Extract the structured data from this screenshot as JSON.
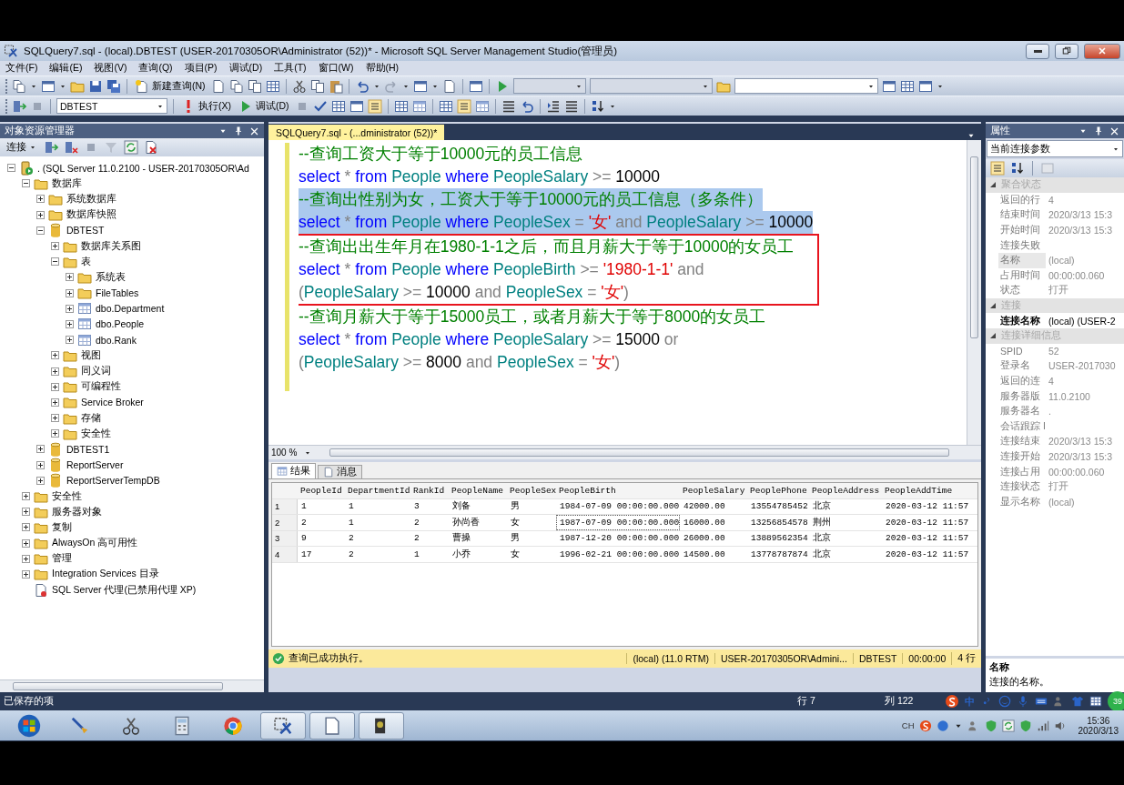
{
  "window": {
    "title": "SQLQuery7.sql - (local).DBTEST (USER-20170305OR\\Administrator (52))* - Microsoft SQL Server Management Studio(管理员)"
  },
  "menu": [
    "文件(F)",
    "编辑(E)",
    "视图(V)",
    "查询(Q)",
    "项目(P)",
    "调试(D)",
    "工具(T)",
    "窗口(W)",
    "帮助(H)"
  ],
  "toolbar": {
    "new_query": "新建查询(N)",
    "database": "DBTEST",
    "execute": "执行(X)",
    "debug": "调试(D)"
  },
  "object_explorer": {
    "title": "对象资源管理器",
    "connect": "连接",
    "tree": [
      {
        "label": ". (SQL Server 11.0.2100 - USER-20170305OR\\Ad",
        "kind": "server",
        "expanded": true,
        "children": [
          {
            "label": "数据库",
            "kind": "folder",
            "expanded": true,
            "children": [
              {
                "label": "系统数据库",
                "kind": "folder",
                "expanded": false
              },
              {
                "label": "数据库快照",
                "kind": "folder",
                "expanded": false
              },
              {
                "label": "DBTEST",
                "kind": "database",
                "expanded": true,
                "children": [
                  {
                    "label": "数据库关系图",
                    "kind": "folder",
                    "expanded": false
                  },
                  {
                    "label": "表",
                    "kind": "folder",
                    "expanded": true,
                    "children": [
                      {
                        "label": "系统表",
                        "kind": "folder",
                        "expanded": false
                      },
                      {
                        "label": "FileTables",
                        "kind": "folder",
                        "expanded": false
                      },
                      {
                        "label": "dbo.Department",
                        "kind": "table",
                        "expanded": false
                      },
                      {
                        "label": "dbo.People",
                        "kind": "table",
                        "expanded": false
                      },
                      {
                        "label": "dbo.Rank",
                        "kind": "table",
                        "expanded": false
                      }
                    ]
                  },
                  {
                    "label": "视图",
                    "kind": "folder",
                    "expanded": false
                  },
                  {
                    "label": "同义词",
                    "kind": "folder",
                    "expanded": false
                  },
                  {
                    "label": "可编程性",
                    "kind": "folder",
                    "expanded": false
                  },
                  {
                    "label": "Service Broker",
                    "kind": "folder",
                    "expanded": false
                  },
                  {
                    "label": "存储",
                    "kind": "folder",
                    "expanded": false
                  },
                  {
                    "label": "安全性",
                    "kind": "folder",
                    "expanded": false
                  }
                ]
              },
              {
                "label": "DBTEST1",
                "kind": "database",
                "expanded": false
              },
              {
                "label": "ReportServer",
                "kind": "database",
                "expanded": false
              },
              {
                "label": "ReportServerTempDB",
                "kind": "database",
                "expanded": false
              }
            ]
          },
          {
            "label": "安全性",
            "kind": "folder",
            "expanded": false
          },
          {
            "label": "服务器对象",
            "kind": "folder",
            "expanded": false
          },
          {
            "label": "复制",
            "kind": "folder",
            "expanded": false
          },
          {
            "label": "AlwaysOn 高可用性",
            "kind": "folder",
            "expanded": false
          },
          {
            "label": "管理",
            "kind": "folder",
            "expanded": false
          },
          {
            "label": "Integration Services 目录",
            "kind": "folder",
            "expanded": false
          },
          {
            "label": "SQL Server 代理(已禁用代理 XP)",
            "kind": "agent"
          }
        ]
      }
    ]
  },
  "editor": {
    "tab": "SQLQuery7.sql - (...dministrator (52))*",
    "zoom": "100 %",
    "lines": [
      {
        "selected": false,
        "boxed": false,
        "tokens": [
          {
            "kind": "comment",
            "text": "--查询工资大于等于10000元的员工信息"
          }
        ]
      },
      {
        "selected": false,
        "boxed": false,
        "tokens": [
          {
            "kind": "keyword",
            "text": "select"
          },
          {
            "kind": "operator",
            "text": " * "
          },
          {
            "kind": "keyword",
            "text": "from "
          },
          {
            "kind": "identifier",
            "text": "People "
          },
          {
            "kind": "keyword",
            "text": "where "
          },
          {
            "kind": "identifier",
            "text": "PeopleSalary"
          },
          {
            "kind": "operator",
            "text": " >= "
          },
          {
            "kind": "number",
            "text": "10000"
          }
        ]
      },
      {
        "selected": true,
        "boxed": false,
        "tokens": [
          {
            "kind": "comment",
            "text": "--查询出性别为女，工资大于等于10000元的员工信息（多条件）"
          }
        ]
      },
      {
        "selected": true,
        "boxed": false,
        "tokens": [
          {
            "kind": "keyword",
            "text": "select"
          },
          {
            "kind": "operator",
            "text": " * "
          },
          {
            "kind": "keyword",
            "text": "from "
          },
          {
            "kind": "identifier",
            "text": "People "
          },
          {
            "kind": "keyword",
            "text": "where "
          },
          {
            "kind": "identifier",
            "text": "PeopleSex"
          },
          {
            "kind": "operator",
            "text": " = "
          },
          {
            "kind": "string",
            "text": "'女'"
          },
          {
            "kind": "operator",
            "text": " and "
          },
          {
            "kind": "identifier",
            "text": "PeopleSalary"
          },
          {
            "kind": "operator",
            "text": " >= "
          },
          {
            "kind": "number",
            "text": "10000"
          }
        ]
      },
      {
        "selected": false,
        "boxed": true,
        "tokens": [
          {
            "kind": "comment",
            "text": "--查询出出生年月在1980-1-1之后，而且月薪大于等于10000的女员工"
          }
        ]
      },
      {
        "selected": false,
        "boxed": true,
        "tokens": [
          {
            "kind": "keyword",
            "text": "select"
          },
          {
            "kind": "operator",
            "text": " * "
          },
          {
            "kind": "keyword",
            "text": "from "
          },
          {
            "kind": "identifier",
            "text": "People "
          },
          {
            "kind": "keyword",
            "text": "where "
          },
          {
            "kind": "identifier",
            "text": "PeopleBirth"
          },
          {
            "kind": "operator",
            "text": " >= "
          },
          {
            "kind": "string",
            "text": "'1980-1-1'"
          },
          {
            "kind": "operator",
            "text": " and"
          }
        ]
      },
      {
        "selected": false,
        "boxed": true,
        "tokens": [
          {
            "kind": "operator",
            "text": "("
          },
          {
            "kind": "identifier",
            "text": "PeopleSalary"
          },
          {
            "kind": "operator",
            "text": " >= "
          },
          {
            "kind": "number",
            "text": "10000"
          },
          {
            "kind": "operator",
            "text": " and "
          },
          {
            "kind": "identifier",
            "text": "PeopleSex"
          },
          {
            "kind": "operator",
            "text": " = "
          },
          {
            "kind": "string",
            "text": "'女'"
          },
          {
            "kind": "operator",
            "text": ")"
          }
        ]
      },
      {
        "selected": false,
        "boxed": false,
        "tokens": [
          {
            "kind": "comment",
            "text": "--查询月薪大于等于15000员工，或者月薪大于等于8000的女员工"
          }
        ]
      },
      {
        "selected": false,
        "boxed": false,
        "tokens": [
          {
            "kind": "keyword",
            "text": "select"
          },
          {
            "kind": "operator",
            "text": " * "
          },
          {
            "kind": "keyword",
            "text": "from "
          },
          {
            "kind": "identifier",
            "text": "People "
          },
          {
            "kind": "keyword",
            "text": "where "
          },
          {
            "kind": "identifier",
            "text": "PeopleSalary"
          },
          {
            "kind": "operator",
            "text": " >= "
          },
          {
            "kind": "number",
            "text": "15000"
          },
          {
            "kind": "operator",
            "text": " or"
          }
        ]
      },
      {
        "selected": false,
        "boxed": false,
        "tokens": [
          {
            "kind": "operator",
            "text": "("
          },
          {
            "kind": "identifier",
            "text": "PeopleSalary"
          },
          {
            "kind": "operator",
            "text": " >= "
          },
          {
            "kind": "number",
            "text": "8000"
          },
          {
            "kind": "operator",
            "text": " and "
          },
          {
            "kind": "identifier",
            "text": "PeopleSex"
          },
          {
            "kind": "operator",
            "text": " = "
          },
          {
            "kind": "string",
            "text": "'女'"
          },
          {
            "kind": "operator",
            "text": ")"
          }
        ]
      }
    ]
  },
  "results": {
    "tabs": [
      {
        "label": "结果",
        "selected": true
      },
      {
        "label": "消息",
        "selected": false
      }
    ],
    "columns": [
      "PeopleId",
      "DepartmentId",
      "RankId",
      "PeopleName",
      "PeopleSex",
      "PeopleBirth",
      "PeopleSalary",
      "PeoplePhone",
      "PeopleAddress",
      "PeopleAddTime"
    ],
    "rows": [
      {
        "number": "1",
        "cells": [
          {
            "text": "1",
            "focused": false
          },
          {
            "text": "1",
            "focused": false
          },
          {
            "text": "3",
            "focused": false
          },
          {
            "text": "刘备",
            "focused": false
          },
          {
            "text": "男",
            "focused": false
          },
          {
            "text": "1984-07-09 00:00:00.000",
            "focused": false
          },
          {
            "text": "42000.00",
            "focused": false
          },
          {
            "text": "13554785452",
            "focused": false
          },
          {
            "text": "北京",
            "focused": false
          },
          {
            "text": "2020-03-12 11:57",
            "focused": false
          }
        ]
      },
      {
        "number": "2",
        "cells": [
          {
            "text": "2",
            "focused": false
          },
          {
            "text": "1",
            "focused": false
          },
          {
            "text": "2",
            "focused": false
          },
          {
            "text": "孙尚香",
            "focused": false
          },
          {
            "text": "女",
            "focused": false
          },
          {
            "text": "1987-07-09 00:00:00.000",
            "focused": true
          },
          {
            "text": "16000.00",
            "focused": false
          },
          {
            "text": "13256854578",
            "focused": false
          },
          {
            "text": "荆州",
            "focused": false
          },
          {
            "text": "2020-03-12 11:57",
            "focused": false
          }
        ]
      },
      {
        "number": "3",
        "cells": [
          {
            "text": "9",
            "focused": false
          },
          {
            "text": "2",
            "focused": false
          },
          {
            "text": "2",
            "focused": false
          },
          {
            "text": "曹操",
            "focused": false
          },
          {
            "text": "男",
            "focused": false
          },
          {
            "text": "1987-12-20 00:00:00.000",
            "focused": false
          },
          {
            "text": "26000.00",
            "focused": false
          },
          {
            "text": "13889562354",
            "focused": false
          },
          {
            "text": "北京",
            "focused": false
          },
          {
            "text": "2020-03-12 11:57",
            "focused": false
          }
        ]
      },
      {
        "number": "4",
        "cells": [
          {
            "text": "17",
            "focused": false
          },
          {
            "text": "2",
            "focused": false
          },
          {
            "text": "1",
            "focused": false
          },
          {
            "text": "小乔",
            "focused": false
          },
          {
            "text": "女",
            "focused": false
          },
          {
            "text": "1996-02-21 00:00:00.000",
            "focused": false
          },
          {
            "text": "14500.00",
            "focused": false
          },
          {
            "text": "13778787874",
            "focused": false
          },
          {
            "text": "北京",
            "focused": false
          },
          {
            "text": "2020-03-12 11:57",
            "focused": false
          }
        ]
      }
    ]
  },
  "query_status": {
    "message": "查询已成功执行。",
    "server": "(local) (11.0 RTM)",
    "user": "USER-20170305OR\\Admini...",
    "database": "DBTEST",
    "elapsed": "00:00:00",
    "rows": "4 行"
  },
  "properties": {
    "title": "属性",
    "object": "当前连接参数",
    "sections": [
      {
        "title": "聚合状态",
        "expanded": true,
        "items": [
          {
            "name": "返回的行",
            "value": "4",
            "selected": false,
            "modified": false
          },
          {
            "name": "结束时间",
            "value": "2020/3/13 15:3",
            "selected": false,
            "modified": false
          },
          {
            "name": "开始时间",
            "value": "2020/3/13 15:3",
            "selected": false,
            "modified": false
          },
          {
            "name": "连接失败",
            "selected": false,
            "modified": false
          },
          {
            "name": "名称",
            "value": "(local)",
            "selected": true,
            "modified": false
          },
          {
            "name": "占用时间",
            "value": "00:00:00.060",
            "selected": false,
            "modified": false
          },
          {
            "name": "状态",
            "value": "打开",
            "selected": false,
            "modified": false
          }
        ]
      },
      {
        "title": "连接",
        "expanded": true,
        "items": [
          {
            "name": "连接名称",
            "value": "(local) (USER-2",
            "selected": false,
            "modified": true
          }
        ]
      },
      {
        "title": "连接详细信息",
        "expanded": true,
        "items": [
          {
            "name": "SPID",
            "value": "52",
            "selected": false,
            "modified": false
          },
          {
            "name": "登录名",
            "value": "USER-2017030",
            "selected": false,
            "modified": false
          },
          {
            "name": "返回的连",
            "value": "4",
            "selected": false,
            "modified": false
          },
          {
            "name": "服务器版",
            "value": "11.0.2100",
            "selected": false,
            "modified": false
          },
          {
            "name": "服务器名",
            "value": ".",
            "selected": false,
            "modified": false
          },
          {
            "name": "会话跟踪 I",
            "selected": false,
            "modified": false
          },
          {
            "name": "连接结束",
            "value": "2020/3/13 15:3",
            "selected": false,
            "modified": false
          },
          {
            "name": "连接开始",
            "value": "2020/3/13 15:3",
            "selected": false,
            "modified": false
          },
          {
            "name": "连接占用",
            "value": "00:00:00.060",
            "selected": false,
            "modified": false
          },
          {
            "name": "连接状态",
            "value": "打开",
            "selected": false,
            "modified": false
          },
          {
            "name": "显示名称",
            "value": "(local)",
            "selected": false,
            "modified": false
          }
        ]
      }
    ],
    "description": {
      "title": "名称",
      "text": "连接的名称。"
    }
  },
  "status_bar": {
    "text": "已保存的项",
    "line": "行 7",
    "column": "列 122",
    "ime": "中",
    "badge": "39"
  },
  "taskbar": {
    "language": "CH",
    "time": "15:36",
    "date": "2020/3/13"
  }
}
